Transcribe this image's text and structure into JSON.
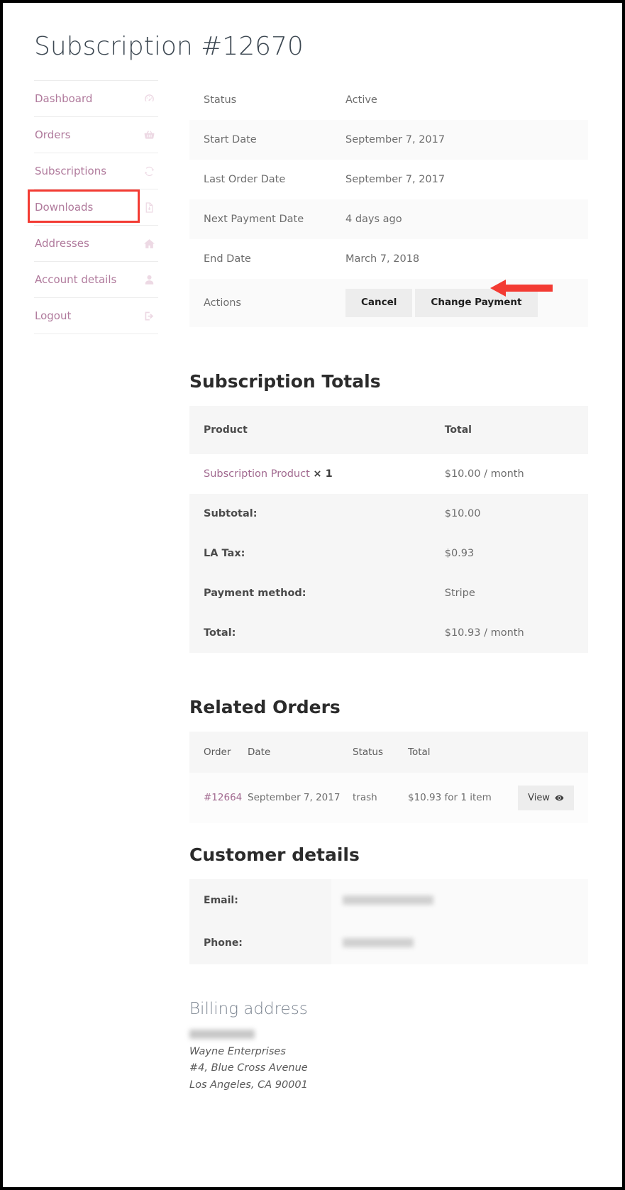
{
  "page": {
    "title": "Subscription #12670"
  },
  "sidebar": {
    "items": [
      {
        "label": "Dashboard",
        "icon": "speedometer-icon"
      },
      {
        "label": "Orders",
        "icon": "basket-icon"
      },
      {
        "label": "Subscriptions",
        "icon": "refresh-icon",
        "highlighted": true
      },
      {
        "label": "Downloads",
        "icon": "file-download-icon"
      },
      {
        "label": "Addresses",
        "icon": "home-icon"
      },
      {
        "label": "Account details",
        "icon": "user-icon"
      },
      {
        "label": "Logout",
        "icon": "sign-out-icon"
      }
    ],
    "accent_color": "#b07a9c",
    "highlight_color": "#f33b33"
  },
  "details": {
    "rows": [
      {
        "label": "Status",
        "value": "Active"
      },
      {
        "label": "Start Date",
        "value": "September 7, 2017"
      },
      {
        "label": "Last Order Date",
        "value": "September 7, 2017"
      },
      {
        "label": "Next Payment Date",
        "value": "4 days ago"
      },
      {
        "label": "End Date",
        "value": "March 7, 2018"
      }
    ],
    "actions_label": "Actions",
    "cancel_label": "Cancel",
    "change_payment_label": "Change Payment"
  },
  "totals": {
    "heading": "Subscription Totals",
    "headers": [
      "Product",
      "Total"
    ],
    "product_name": "Subscription Product",
    "product_qty": "× 1",
    "product_total": "$10.00 / month",
    "rows": [
      {
        "label": "Subtotal:",
        "value": "$10.00"
      },
      {
        "label": "LA Tax:",
        "value": "$0.93"
      },
      {
        "label": "Payment method:",
        "value": "Stripe"
      },
      {
        "label": "Total:",
        "value": "$10.93 / month"
      }
    ]
  },
  "related_orders": {
    "heading": "Related Orders",
    "headers": [
      "Order",
      "Date",
      "Status",
      "Total"
    ],
    "rows": [
      {
        "order": "#12664",
        "date": "September 7, 2017",
        "status": "trash",
        "total": "$10.93 for 1 item",
        "action_label": "View"
      }
    ]
  },
  "customer_details": {
    "heading": "Customer details",
    "rows": [
      {
        "label": "Email:",
        "value": "",
        "redacted": true
      },
      {
        "label": "Phone:",
        "value": "",
        "redacted": true
      }
    ]
  },
  "billing_address": {
    "heading": "Billing address",
    "name_redacted": true,
    "lines": [
      "Wayne Enterprises",
      "#4, Blue Cross Avenue",
      "Los Angeles, CA 90001"
    ]
  }
}
